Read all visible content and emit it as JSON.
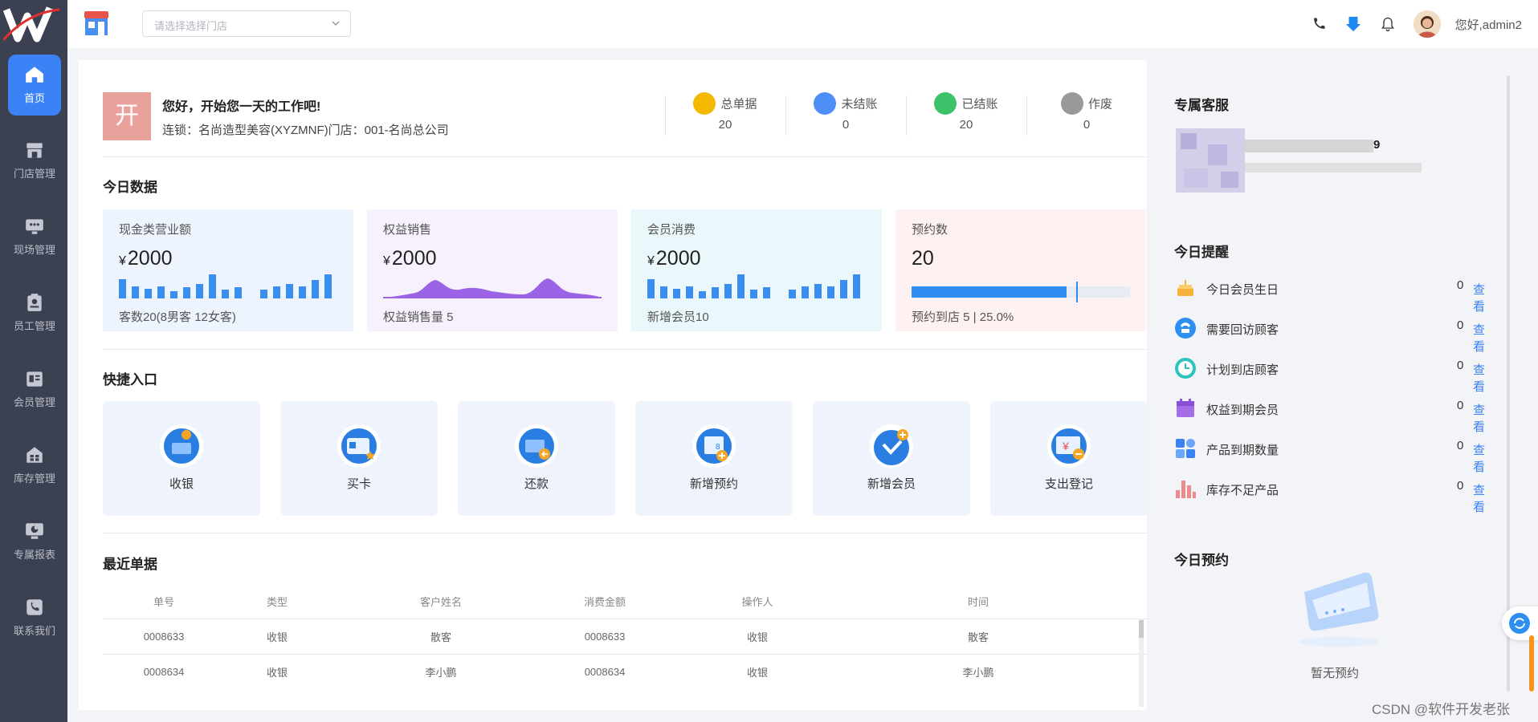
{
  "sidebar": {
    "items": [
      {
        "label": "首页",
        "icon": "home-icon"
      },
      {
        "label": "门店管理",
        "icon": "store-icon"
      },
      {
        "label": "现场管理",
        "icon": "monitor-icon"
      },
      {
        "label": "员工管理",
        "icon": "clipboard-icon"
      },
      {
        "label": "会员管理",
        "icon": "member-card-icon"
      },
      {
        "label": "库存管理",
        "icon": "inventory-icon"
      },
      {
        "label": "专属报表",
        "icon": "report-icon"
      },
      {
        "label": "联系我们",
        "icon": "phone-book-icon"
      }
    ],
    "active_color": "#3a82f6",
    "bg_color": "#3c4152"
  },
  "header": {
    "store_placeholder": "请选择选择门店",
    "greeting": "您好,admin2"
  },
  "welcome": {
    "avatar_char": "开",
    "title": "您好，开始您一天的工作吧!",
    "subtitle": "连锁：名尚造型美容(XYZMNF)门店：001-名尚总公司"
  },
  "stats": [
    {
      "label": "总单据",
      "value": "20",
      "color": "#f5b800"
    },
    {
      "label": "未结账",
      "value": "0",
      "color": "#4e8ef7"
    },
    {
      "label": "已结账",
      "value": "20",
      "color": "#3cc36a"
    },
    {
      "label": "作废",
      "value": "0",
      "color": "#999999"
    }
  ],
  "today": {
    "title": "今日数据",
    "cards": [
      {
        "title": "现金类营业额",
        "currency": "¥",
        "value": "2000",
        "footer": "客数20(8男客 12女客)",
        "bg": "#eef4fd"
      },
      {
        "title": "权益销售",
        "currency": "¥",
        "value": "2000",
        "footer": "权益销售量 5",
        "bg": "#f6f1fd"
      },
      {
        "title": "会员消费",
        "currency": "¥",
        "value": "2000",
        "footer": "新增会员10",
        "bg": "#eaf8fb"
      },
      {
        "title": "预约数",
        "currency": "",
        "value": "20",
        "footer": "预约到店 5 | 25.0%",
        "bg": "#fdf1f1",
        "progress": 0.71
      }
    ]
  },
  "quick": {
    "title": "快捷入口",
    "items": [
      {
        "label": "收银",
        "icon": "cashier-icon"
      },
      {
        "label": "买卡",
        "icon": "buy-card-icon"
      },
      {
        "label": "还款",
        "icon": "repayment-icon"
      },
      {
        "label": "新增预约",
        "icon": "calendar-add-icon"
      },
      {
        "label": "新增会员",
        "icon": "add-member-icon"
      },
      {
        "label": "支出登记",
        "icon": "expense-icon"
      }
    ]
  },
  "recent": {
    "title": "最近单据",
    "columns": [
      "单号",
      "类型",
      "客户姓名",
      "消费金额",
      "操作人",
      "时间"
    ],
    "rows": [
      [
        "0008633",
        "收银",
        "散客",
        "0008633",
        "收银",
        "散客"
      ],
      [
        "0008634",
        "收银",
        "李小鹏",
        "0008634",
        "收银",
        "李小鹏"
      ]
    ]
  },
  "right": {
    "service_title": "专属客服",
    "service_digit": "9",
    "remind_title": "今日提醒",
    "view_label": "查看",
    "reminders": [
      {
        "label": "今日会员生日",
        "count": "0",
        "icon": "cake-icon"
      },
      {
        "label": "需要回访顾客",
        "count": "0",
        "icon": "phone-icon"
      },
      {
        "label": "计划到店顾客",
        "count": "0",
        "icon": "clock-icon"
      },
      {
        "label": "权益到期会员",
        "count": "0",
        "icon": "calendar-icon"
      },
      {
        "label": "产品到期数量",
        "count": "0",
        "icon": "grid-icon"
      },
      {
        "label": "库存不足产品",
        "count": "0",
        "icon": "bar-chart-icon"
      }
    ],
    "booking_title": "今日预约",
    "empty_text": "暂无预约"
  },
  "watermark": "CSDN @软件开发老张"
}
